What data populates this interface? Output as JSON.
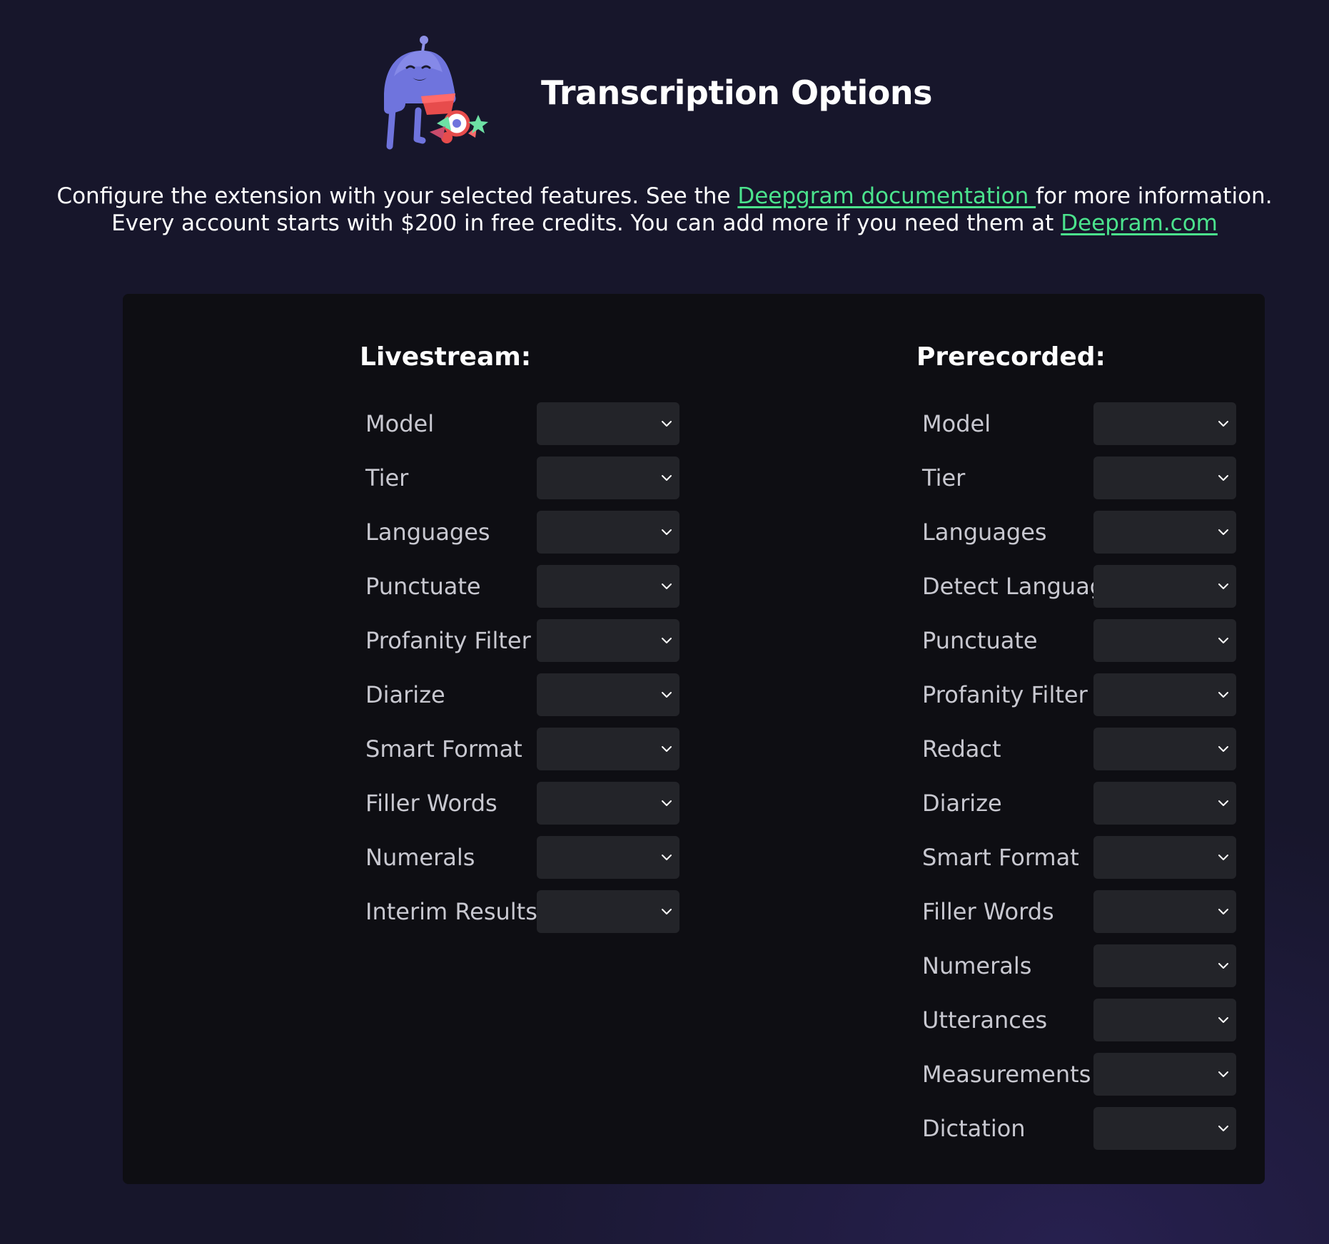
{
  "header": {
    "title": "Transcription Options",
    "mascot_icon": "deepgram-robot-mascot-illustration"
  },
  "intro": {
    "line1_before": "Configure the extension with your selected features. See the ",
    "docs_link": "Deepgram documentation ",
    "line1_after": "for more information.",
    "line2_before": "Every account starts with $200 in free credits. You can add more if you need them at ",
    "site_link": "Deepram.com",
    "link_color": "#4be38d"
  },
  "livestream": {
    "title": "Livestream:",
    "fields": [
      {
        "label": "Model",
        "value": ""
      },
      {
        "label": "Tier",
        "value": ""
      },
      {
        "label": "Languages",
        "value": ""
      },
      {
        "label": "Punctuate",
        "value": ""
      },
      {
        "label": "Profanity Filter",
        "value": ""
      },
      {
        "label": "Diarize",
        "value": ""
      },
      {
        "label": "Smart Format",
        "value": ""
      },
      {
        "label": "Filler Words",
        "value": ""
      },
      {
        "label": "Numerals",
        "value": ""
      },
      {
        "label": "Interim Results",
        "value": ""
      }
    ]
  },
  "prerecorded": {
    "title": "Prerecorded:",
    "fields": [
      {
        "label": "Model",
        "value": ""
      },
      {
        "label": "Tier",
        "value": ""
      },
      {
        "label": "Languages",
        "value": ""
      },
      {
        "label": "Detect Language",
        "value": ""
      },
      {
        "label": "Punctuate",
        "value": ""
      },
      {
        "label": "Profanity Filter",
        "value": ""
      },
      {
        "label": "Redact",
        "value": ""
      },
      {
        "label": "Diarize",
        "value": ""
      },
      {
        "label": "Smart Format",
        "value": ""
      },
      {
        "label": "Filler Words",
        "value": ""
      },
      {
        "label": "Numerals",
        "value": ""
      },
      {
        "label": "Utterances",
        "value": ""
      },
      {
        "label": "Measurements",
        "value": ""
      },
      {
        "label": "Dictation",
        "value": ""
      }
    ]
  },
  "theme": {
    "background": "#17162b",
    "card": "#0e0e13",
    "select": "#232429",
    "label": "#c8c8d0"
  }
}
